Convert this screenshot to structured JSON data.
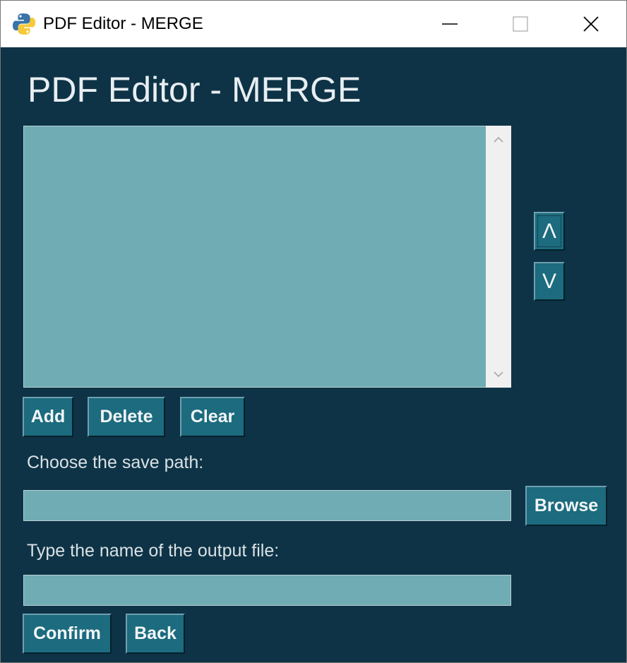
{
  "window": {
    "title": "PDF Editor - MERGE",
    "controls": {
      "minimize": "minimize-icon",
      "maximize": "maximize-icon",
      "close": "close-icon"
    }
  },
  "main": {
    "heading": "PDF Editor - MERGE",
    "file_list": {
      "items": []
    },
    "reorder": {
      "up_label": "Λ",
      "down_label": "V"
    },
    "list_actions": {
      "add_label": "Add",
      "delete_label": "Delete",
      "clear_label": "Clear"
    },
    "save_path": {
      "label": "Choose the save path:",
      "value": "",
      "browse_label": "Browse"
    },
    "output_name": {
      "label": "Type the name of the output file:",
      "value": ""
    },
    "footer": {
      "confirm_label": "Confirm",
      "back_label": "Back"
    }
  },
  "colors": {
    "background": "#0e3346",
    "field": "#70acb4",
    "button": "#1c6b7e",
    "text": "#e8eef2"
  }
}
